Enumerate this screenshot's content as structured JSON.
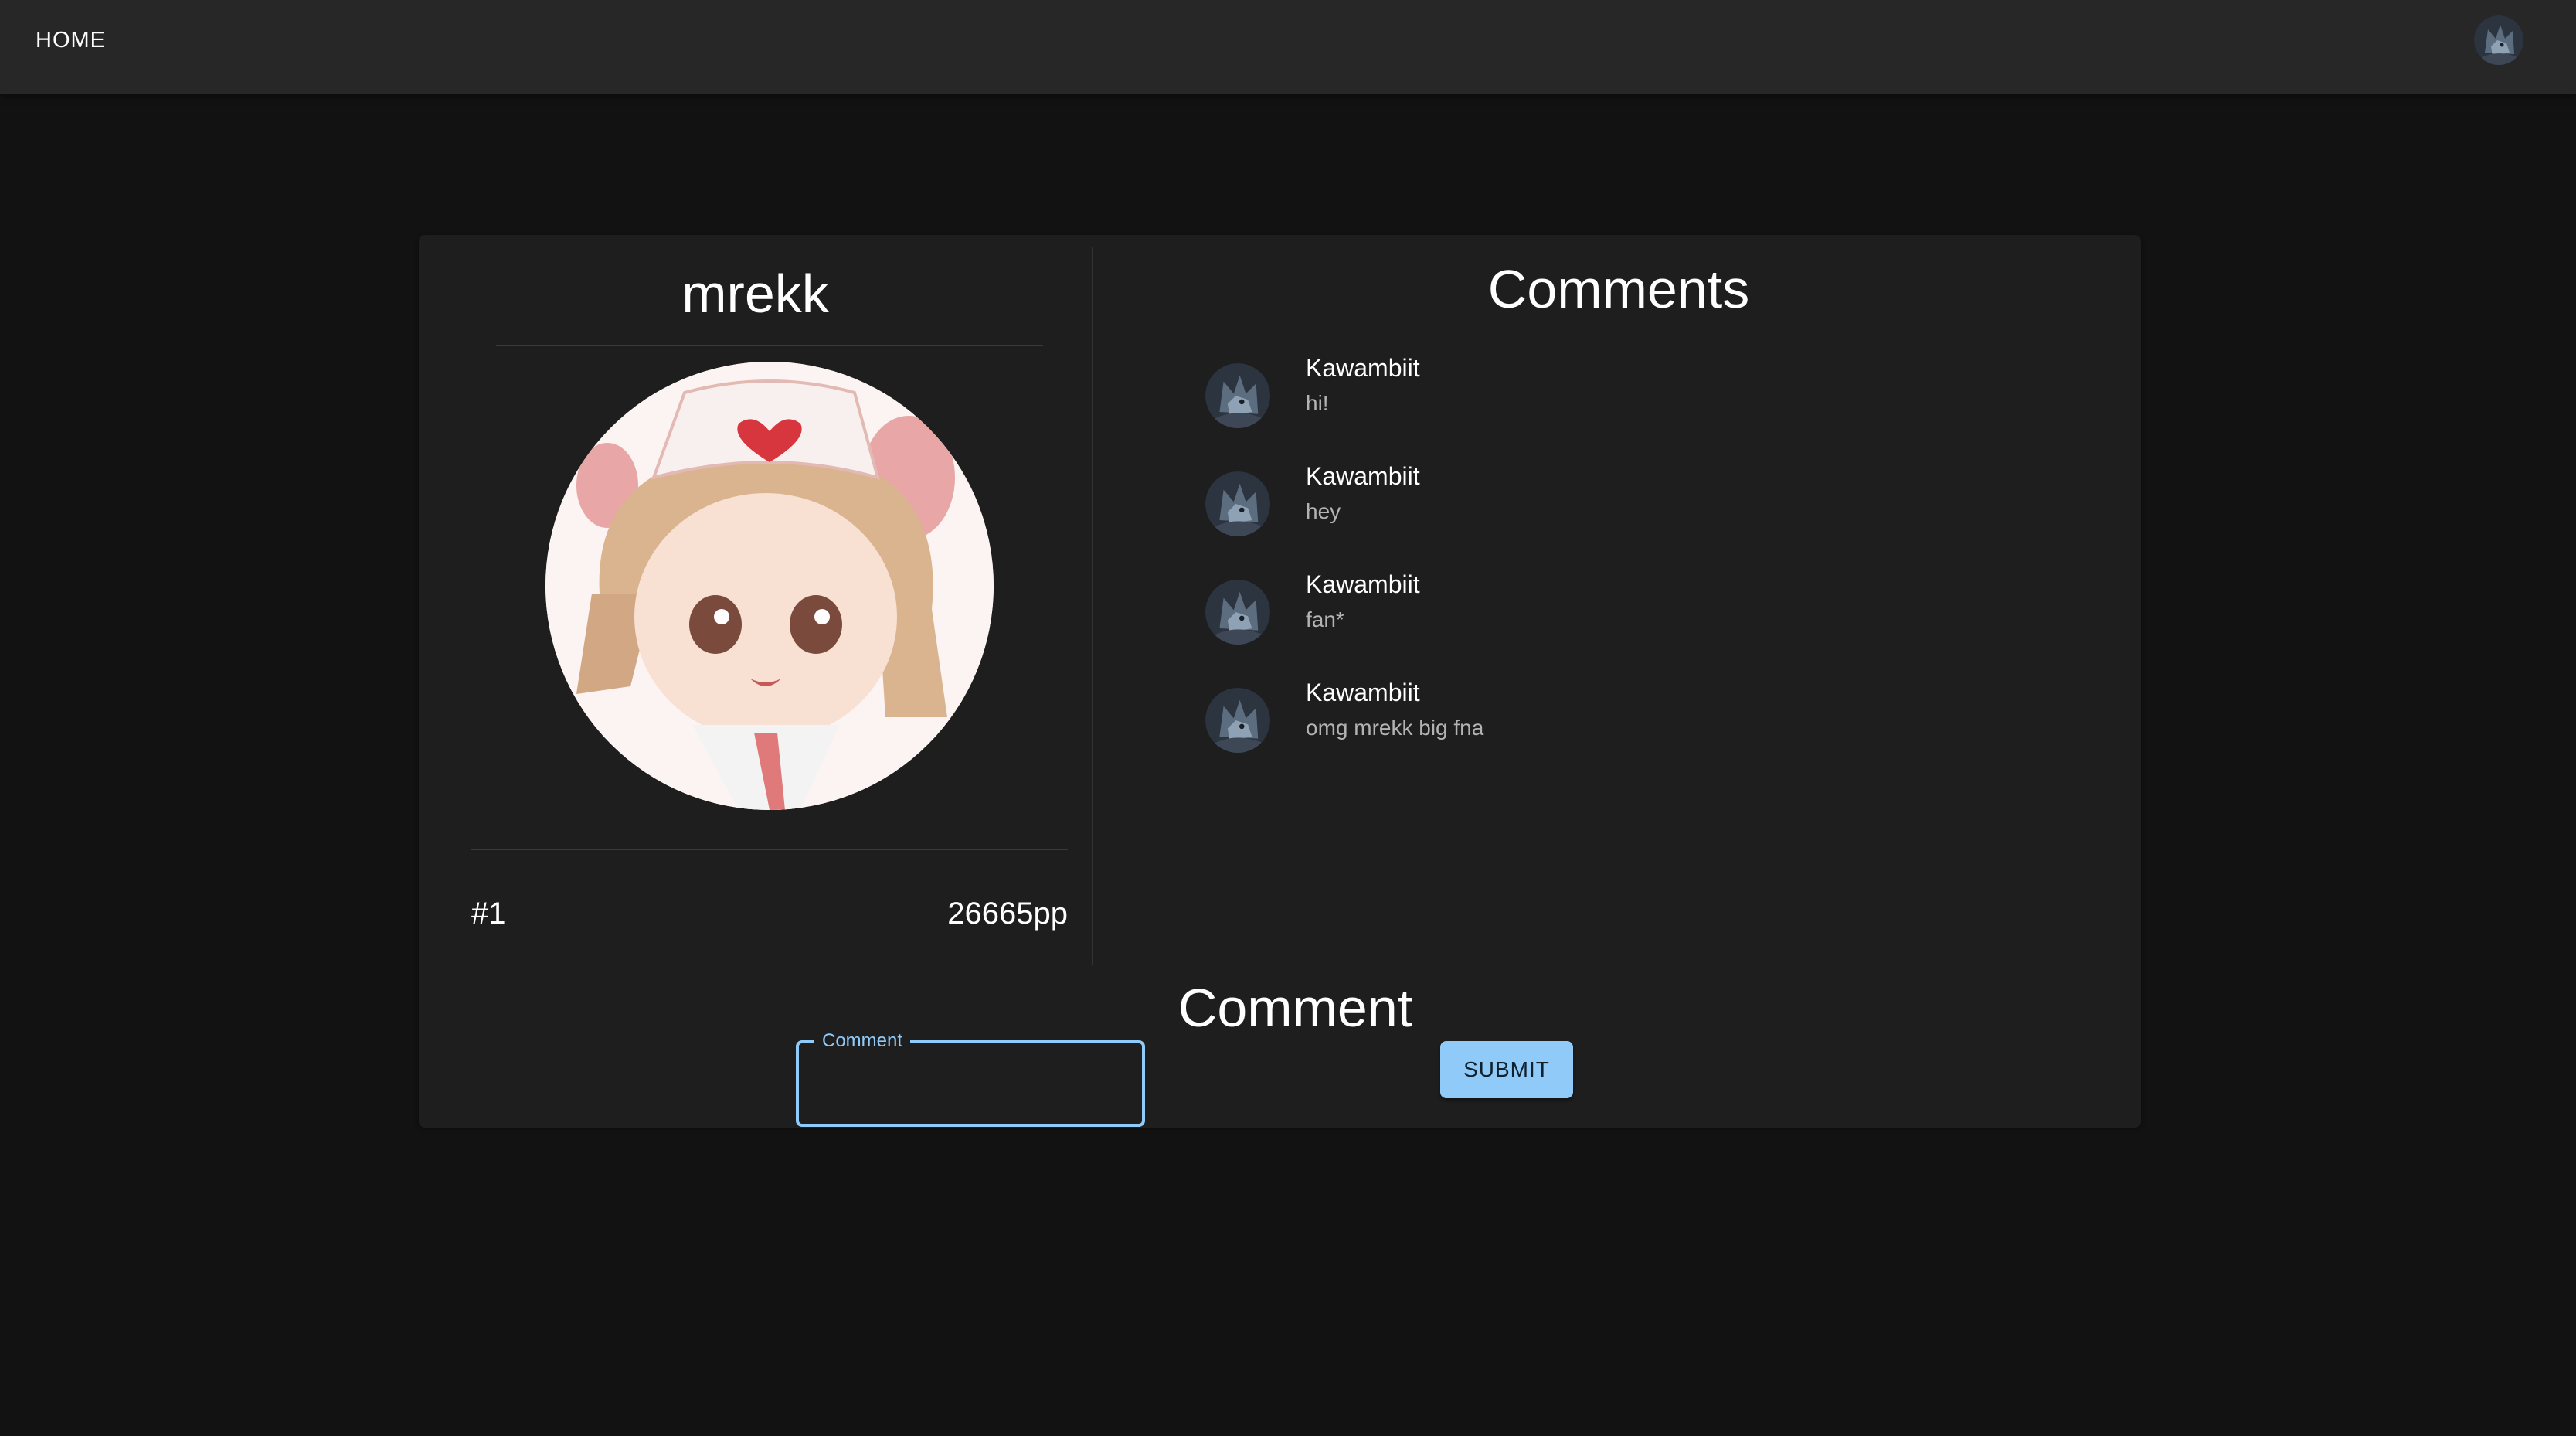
{
  "appbar": {
    "home_label": "HOME",
    "user_avatar_icon": "wolf-avatar-icon"
  },
  "profile": {
    "username": "mrekk",
    "rank": "#1",
    "pp": "26665pp",
    "picture_icon": "anime-nurse-avatar"
  },
  "comments": {
    "title": "Comments",
    "items": [
      {
        "author": "Kawambiit",
        "text": "hi!"
      },
      {
        "author": "Kawambiit",
        "text": "hey"
      },
      {
        "author": "Kawambiit",
        "text": "fan*"
      },
      {
        "author": "Kawambiit",
        "text": "omg mrekk big fna"
      }
    ]
  },
  "comment_form": {
    "title": "Comment",
    "field_label": "Comment",
    "field_value": "",
    "submit_label": "SUBMIT"
  },
  "colors": {
    "background": "#121212",
    "appbar": "#272727",
    "card": "#1e1e1e",
    "accent": "#90caf9"
  }
}
